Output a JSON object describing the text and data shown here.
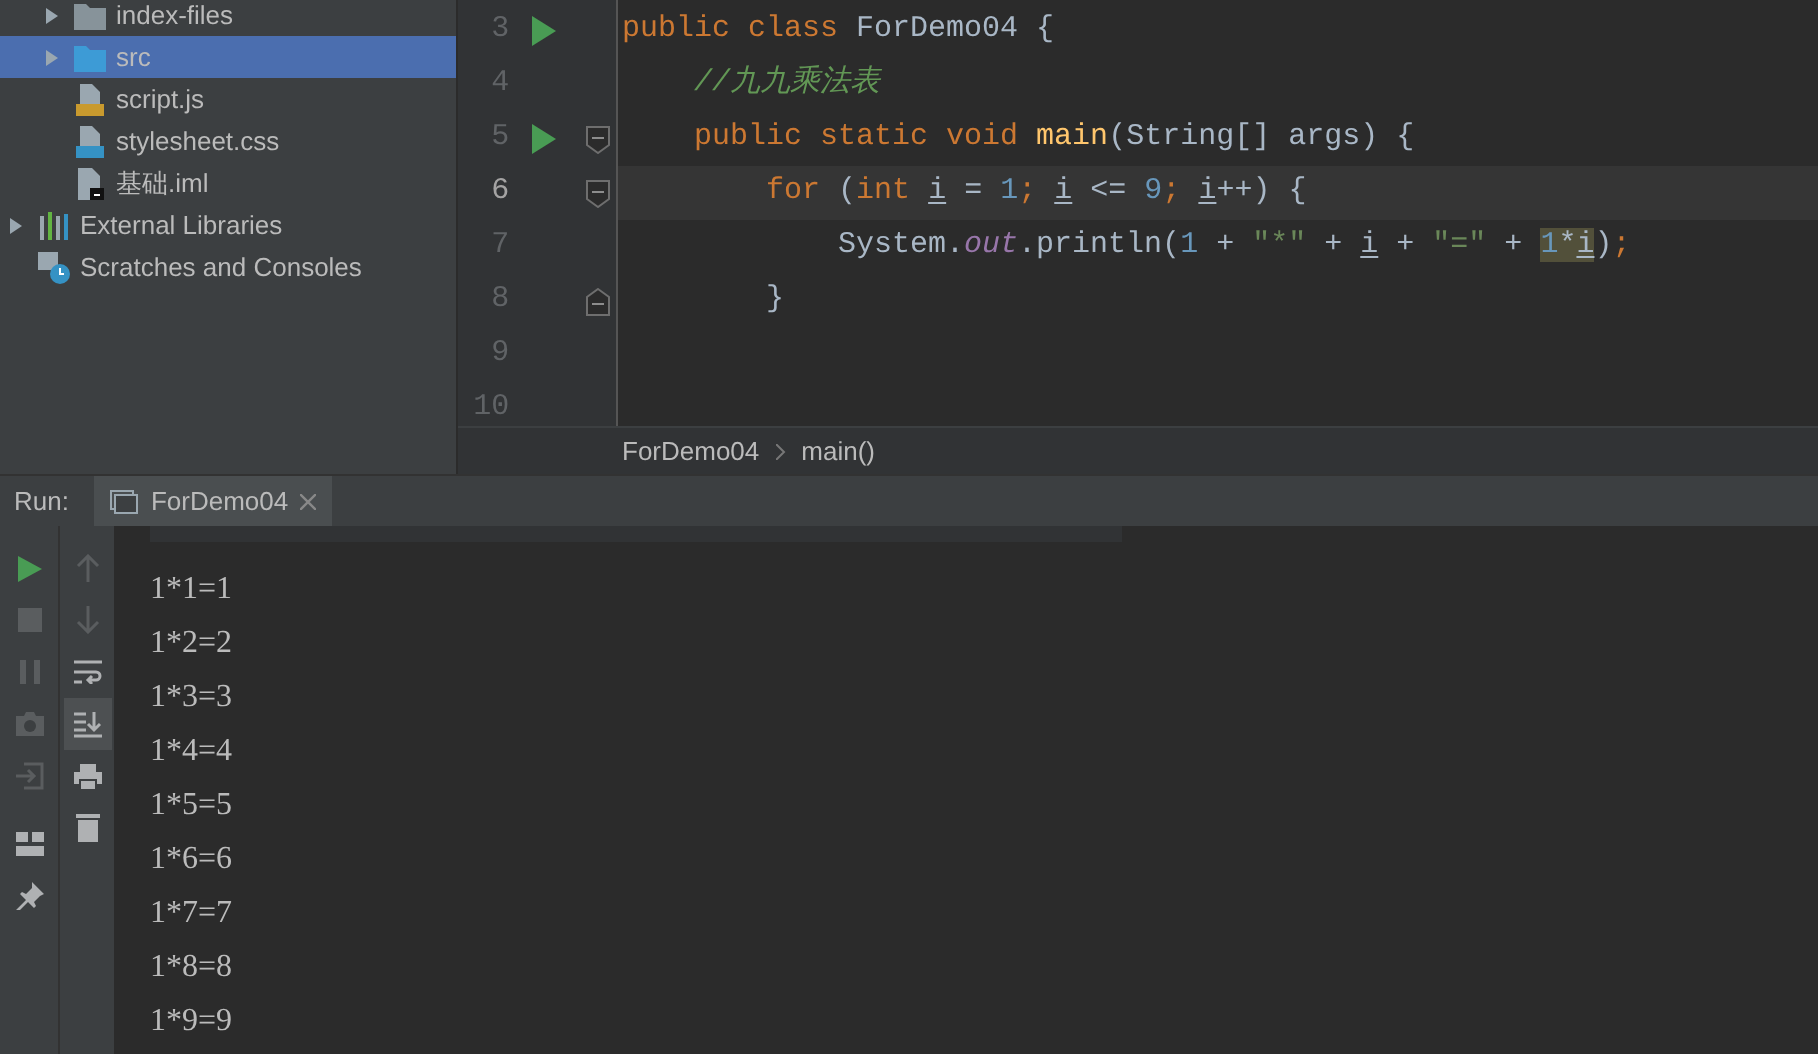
{
  "project_tree": {
    "items": [
      {
        "kind": "group",
        "children": [
          {
            "label": "index-files",
            "kind": "folder",
            "expanded": false,
            "selected": false
          },
          {
            "label": "src",
            "kind": "source-folder",
            "expanded": false,
            "selected": true
          },
          {
            "label": "script.js",
            "kind": "js",
            "selected": false
          },
          {
            "label": "stylesheet.css",
            "kind": "css",
            "selected": false
          },
          {
            "label": "基础.iml",
            "kind": "iml",
            "selected": false
          }
        ]
      },
      {
        "label": "External Libraries",
        "kind": "libraries",
        "expanded": false,
        "selected": false
      },
      {
        "label": "Scratches and Consoles",
        "kind": "scratches",
        "selected": false
      }
    ]
  },
  "editor": {
    "lines": [
      {
        "number": "3",
        "run_marker": true,
        "tokens": [
          {
            "text": "public class ",
            "kind": "keyword"
          },
          {
            "text": "ForDemo04 {",
            "kind": "plain"
          }
        ]
      },
      {
        "number": "4",
        "tokens": [
          {
            "text": "    //九九乘法表",
            "kind": "comment"
          }
        ]
      },
      {
        "number": "5",
        "run_marker": true,
        "fold_start": true,
        "tokens": [
          {
            "text": "    public static void ",
            "kind": "keyword"
          },
          {
            "text": "main",
            "kind": "method"
          },
          {
            "text": "(String[] args) {",
            "kind": "plain"
          }
        ]
      },
      {
        "number": "6",
        "fold_start": true,
        "current": true,
        "tokens": [
          {
            "text": "        for ",
            "kind": "keyword"
          },
          {
            "text": "(",
            "kind": "plain"
          },
          {
            "text": "int ",
            "kind": "keyword"
          },
          {
            "text": "i",
            "kind": "variable"
          },
          {
            "text": " = ",
            "kind": "plain"
          },
          {
            "text": "1",
            "kind": "number"
          },
          {
            "text": "; ",
            "kind": "keyword"
          },
          {
            "text": "i",
            "kind": "variable"
          },
          {
            "text": " <= ",
            "kind": "plain"
          },
          {
            "text": "9",
            "kind": "number"
          },
          {
            "text": "; ",
            "kind": "keyword"
          },
          {
            "text": "i",
            "kind": "variable"
          },
          {
            "text": "++) {",
            "kind": "plain"
          }
        ]
      },
      {
        "number": "7",
        "tokens": [
          {
            "text": "            System.",
            "kind": "plain"
          },
          {
            "text": "out",
            "kind": "field"
          },
          {
            "text": ".println(",
            "kind": "plain"
          },
          {
            "text": "1",
            "kind": "number"
          },
          {
            "text": " + ",
            "kind": "plain"
          },
          {
            "text": "\"*\"",
            "kind": "string"
          },
          {
            "text": " + ",
            "kind": "plain"
          },
          {
            "text": "i",
            "kind": "variable"
          },
          {
            "text": " + ",
            "kind": "plain"
          },
          {
            "text": "\"=\"",
            "kind": "string"
          },
          {
            "text": " + ",
            "kind": "plain"
          },
          {
            "text": "1",
            "kind": "highlight-number"
          },
          {
            "text": "*",
            "kind": "highlight"
          },
          {
            "text": "i",
            "kind": "highlight-variable"
          },
          {
            "text": ")",
            "kind": "plain"
          },
          {
            "text": ";",
            "kind": "keyword"
          }
        ]
      },
      {
        "number": "8",
        "fold_end": true,
        "tokens": [
          {
            "text": "        }",
            "kind": "plain"
          }
        ]
      },
      {
        "number": "9"
      },
      {
        "number": "10"
      }
    ],
    "breadcrumbs": [
      "ForDemo04",
      "main()"
    ]
  },
  "run_panel": {
    "label": "Run:",
    "tab": {
      "title": "ForDemo04",
      "selected": true
    },
    "left_tools": [
      {
        "kind": "play",
        "disabled": false
      },
      {
        "kind": "stop",
        "disabled": true
      },
      {
        "kind": "pause",
        "disabled": true
      },
      {
        "kind": "camera",
        "disabled": true
      },
      {
        "kind": "enter",
        "disabled": true
      },
      {
        "kind": "layout",
        "disabled": false
      },
      {
        "kind": "pin",
        "disabled": false
      }
    ],
    "right_tools": [
      {
        "kind": "up",
        "disabled": true,
        "selected": false
      },
      {
        "kind": "down",
        "disabled": true,
        "selected": false
      },
      {
        "kind": "wrap",
        "disabled": false,
        "selected": false
      },
      {
        "kind": "scroll-end",
        "disabled": false,
        "selected": true
      },
      {
        "kind": "print",
        "disabled": false,
        "selected": false
      },
      {
        "kind": "trash",
        "disabled": false,
        "selected": false
      }
    ],
    "output": [
      "1*1=1",
      "1*2=2",
      "1*3=3",
      "1*4=4",
      "1*5=5",
      "1*6=6",
      "1*7=7",
      "1*8=8",
      "1*9=9"
    ]
  }
}
